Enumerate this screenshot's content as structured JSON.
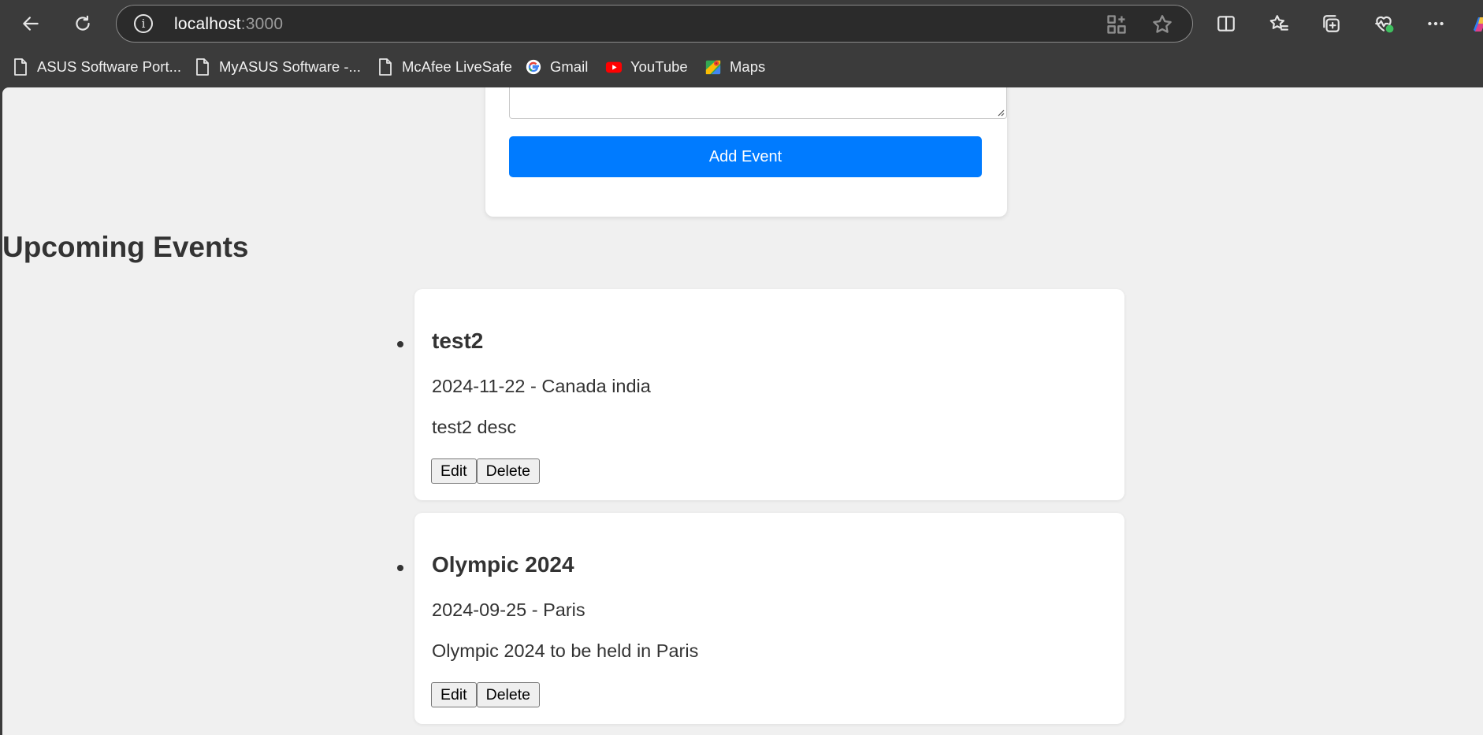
{
  "browser": {
    "url_host": "localhost",
    "url_port": ":3000",
    "toolbar_icons": [
      "back-icon",
      "refresh-icon",
      "split-screen-icon",
      "favorites-icon",
      "collections-icon",
      "browser-essentials-icon",
      "more-icon",
      "copilot-icon"
    ],
    "address_icons": [
      "site-info-icon",
      "apps-icon",
      "star-icon"
    ]
  },
  "bookmarks": [
    {
      "label": "ASUS Software Port...",
      "icon": "page-icon"
    },
    {
      "label": "MyASUS Software -...",
      "icon": "page-icon"
    },
    {
      "label": "McAfee LiveSafe",
      "icon": "page-icon"
    },
    {
      "label": "Gmail",
      "icon": "google-icon"
    },
    {
      "label": "YouTube",
      "icon": "youtube-icon"
    },
    {
      "label": "Maps",
      "icon": "maps-icon"
    }
  ],
  "form": {
    "submit_label": "Add Event",
    "accent_color": "#007bff"
  },
  "events": {
    "heading": "Upcoming Events",
    "items": [
      {
        "title": "test2",
        "meta": "2024-11-22 - Canada india",
        "description": "test2 desc",
        "edit_label": "Edit",
        "delete_label": "Delete"
      },
      {
        "title": "Olympic 2024",
        "meta": "2024-09-25 - Paris",
        "description": "Olympic 2024 to be held in Paris",
        "edit_label": "Edit",
        "delete_label": "Delete"
      }
    ]
  }
}
